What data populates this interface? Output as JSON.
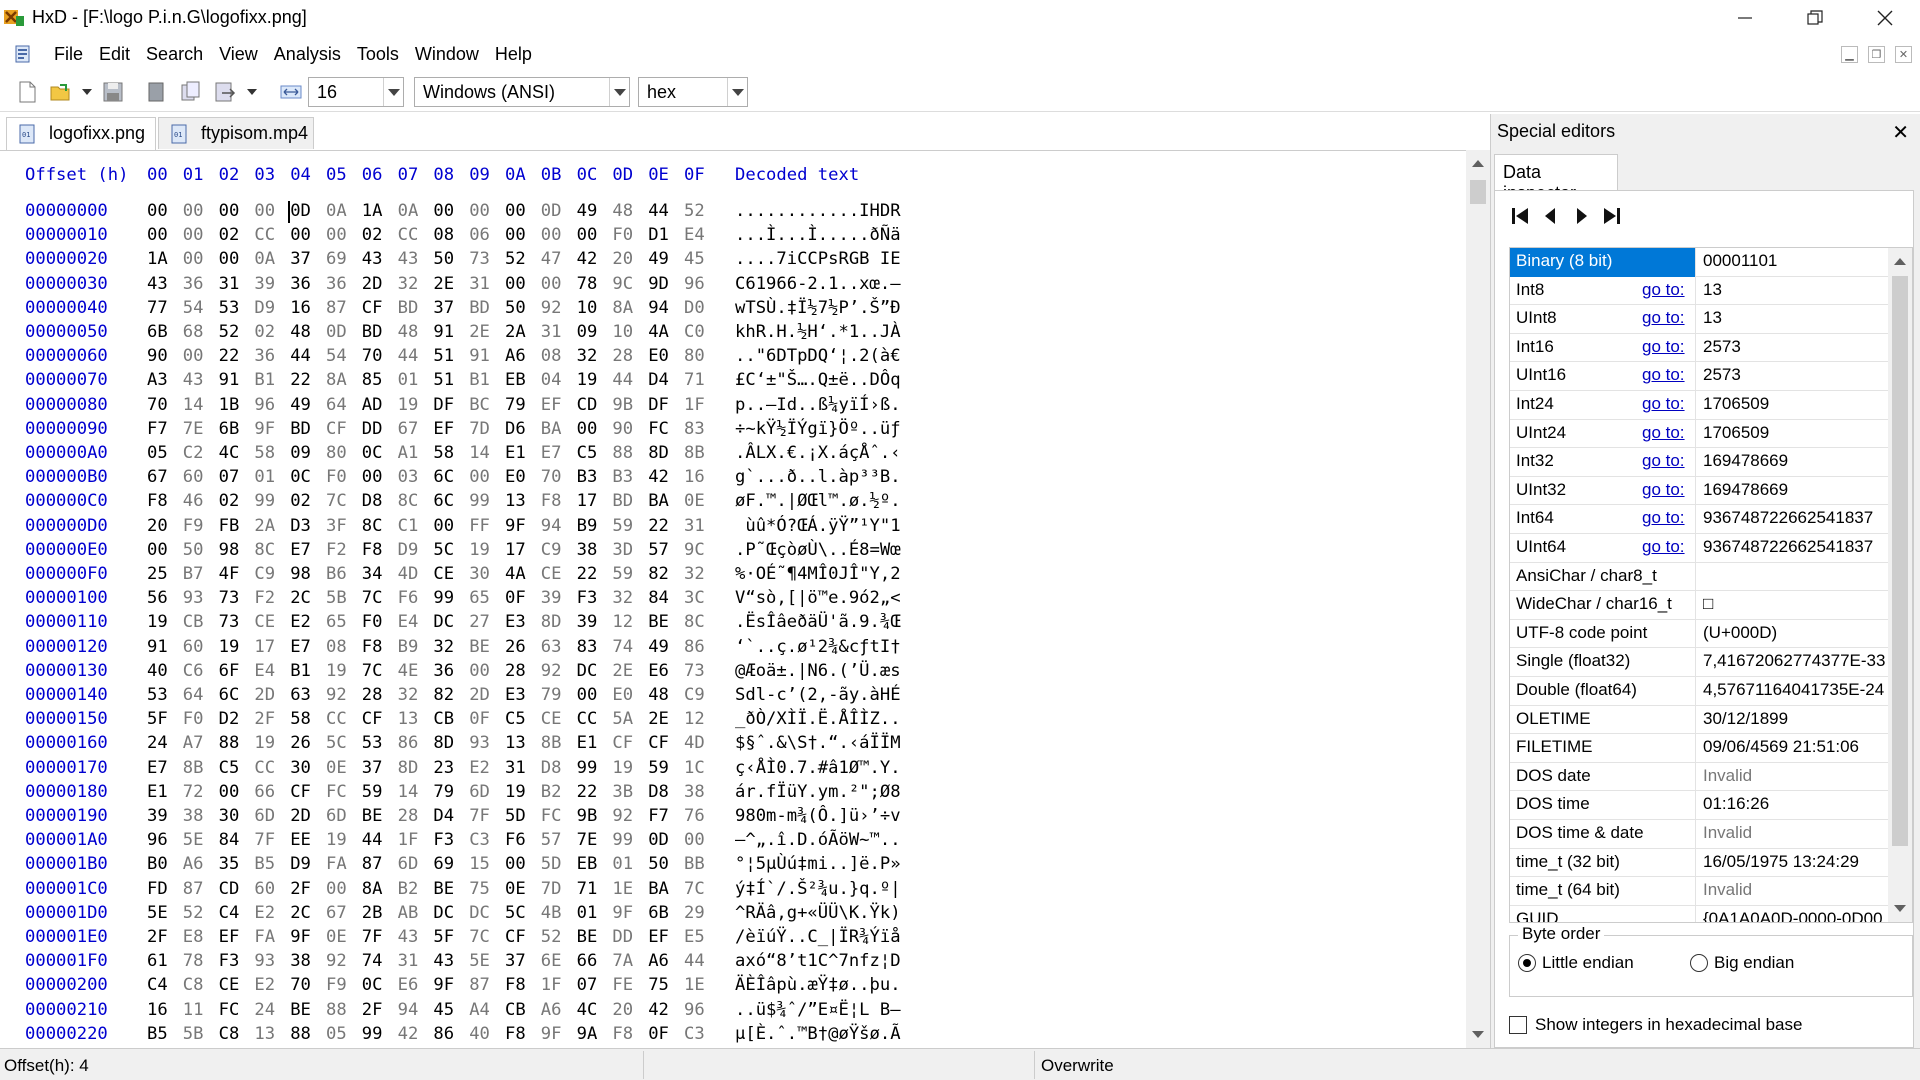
{
  "window": {
    "title": "HxD - [F:\\logo P.i.n.G\\logofixx.png]"
  },
  "menu": [
    "File",
    "Edit",
    "Search",
    "View",
    "Analysis",
    "Tools",
    "Window",
    "Help"
  ],
  "toolbar": {
    "bytes_per_row": "16",
    "charset": "Windows (ANSI)",
    "display": "hex"
  },
  "tabs": [
    {
      "label": "logofixx.png",
      "active": true
    },
    {
      "label": "ftypisom.mp4",
      "active": false
    }
  ],
  "hex": {
    "header_offset": "Offset (h)",
    "header_cols": [
      "00",
      "01",
      "02",
      "03",
      "04",
      "05",
      "06",
      "07",
      "08",
      "09",
      "0A",
      "0B",
      "0C",
      "0D",
      "0E",
      "0F"
    ],
    "header_decoded": "Decoded text",
    "rows": [
      {
        "o": "00000000",
        "b": "00 00 00 00 0D 0A 1A 0A 00 00 00 0D 49 48 44 52",
        "t": "............IHDR"
      },
      {
        "o": "00000010",
        "b": "00 00 02 CC 00 00 02 CC 08 06 00 00 00 F0 D1 E4",
        "t": "...Ì...Ì.....ðÑä"
      },
      {
        "o": "00000020",
        "b": "1A 00 00 0A 37 69 43 43 50 73 52 47 42 20 49 45",
        "t": "....7iCCPsRGB IE"
      },
      {
        "o": "00000030",
        "b": "43 36 31 39 36 36 2D 32 2E 31 00 00 78 9C 9D 96",
        "t": "C61966-2.1..xœ.–"
      },
      {
        "o": "00000040",
        "b": "77 54 53 D9 16 87 CF BD 37 BD 50 92 10 8A 94 D0",
        "t": "wTSÙ.‡Ï½7½P’.Š”Ð"
      },
      {
        "o": "00000050",
        "b": "6B 68 52 02 48 0D BD 48 91 2E 2A 31 09 10 4A C0",
        "t": "khR.H.½H‘.*1..JÀ"
      },
      {
        "o": "00000060",
        "b": "90 00 22 36 44 54 70 44 51 91 A6 08 32 28 E0 80",
        "t": "..\"6DTpDQ‘¦.2(à€"
      },
      {
        "o": "00000070",
        "b": "A3 43 91 B1 22 8A 85 01 51 B1 EB 04 19 44 D4 71",
        "t": "£C‘±\"Š….Q±ë..DÔq"
      },
      {
        "o": "00000080",
        "b": "70 14 1B 96 49 64 AD 19 DF BC 79 EF CD 9B DF 1F",
        "t": "p..–Id..ß¼yïÍ›ß."
      },
      {
        "o": "00000090",
        "b": "F7 7E 6B 9F BD CF DD 67 EF 7D D6 BA 00 90 FC 83",
        "t": "÷~kŸ½ÏÝgï}Öº..üƒ"
      },
      {
        "o": "000000A0",
        "b": "05 C2 4C 58 09 80 0C A1 58 14 E1 E7 C5 88 8D 8B",
        "t": ".ÂLX.€.¡X.áçÅˆ.‹"
      },
      {
        "o": "000000B0",
        "b": "67 60 07 01 0C F0 00 03 6C 00 E0 70 B3 B3 42 16",
        "t": "g`...ð..l.àp³³B."
      },
      {
        "o": "000000C0",
        "b": "F8 46 02 99 02 7C D8 8C 6C 99 13 F8 17 BD BA 0E",
        "t": "øF.™.|ØŒl™.ø.½º."
      },
      {
        "o": "000000D0",
        "b": "20 F9 FB 2A D3 3F 8C C1 00 FF 9F 94 B9 59 22 31",
        "t": " ùû*Ó?ŒÁ.ÿŸ”¹Y\"1"
      },
      {
        "o": "000000E0",
        "b": "00 50 98 8C E7 F2 F8 D9 5C 19 17 C9 38 3D 57 9C",
        "t": ".P˜ŒçòøÙ\\..É8=Wœ"
      },
      {
        "o": "000000F0",
        "b": "25 B7 4F C9 98 B6 34 4D CE 30 4A CE 22 59 82 32",
        "t": "%·OÉ˜¶4MÎ0JÎ\"Y‚2"
      },
      {
        "o": "00000100",
        "b": "56 93 73 F2 2C 5B 7C F6 99 65 0F 39 F3 32 84 3C",
        "t": "V“sò,[|ö™e.9ó2„<"
      },
      {
        "o": "00000110",
        "b": "19 CB 73 CE E2 65 F0 E4 DC 27 E3 8D 39 12 BE 8C",
        "t": ".ËsÎâeðäÜ'ã.9.¾Œ"
      },
      {
        "o": "00000120",
        "b": "91 60 19 17 E7 08 F8 B9 32 BE 26 63 83 74 49 86",
        "t": "‘`..ç.ø¹2¾&cƒtI†"
      },
      {
        "o": "00000130",
        "b": "40 C6 6F E4 B1 19 7C 4E 36 00 28 92 DC 2E E6 73",
        "t": "@Æoä±.|N6.(’Ü.æs"
      },
      {
        "o": "00000140",
        "b": "53 64 6C 2D 63 92 28 32 82 2D E3 79 00 E0 48 C9",
        "t": "Sdl-c’(2‚-ãy.àHÉ"
      },
      {
        "o": "00000150",
        "b": "5F F0 D2 2F 58 CC CF 13 CB 0F C5 CE CC 5A 2E 12",
        "t": "_ðÒ/XÌÏ.Ë.ÅÎÌZ.."
      },
      {
        "o": "00000160",
        "b": "24 A7 88 19 26 5C 53 86 8D 93 13 8B E1 CF CF 4D",
        "t": "$§ˆ.&\\S†.“.‹áÏÏM"
      },
      {
        "o": "00000170",
        "b": "E7 8B C5 CC 30 0E 37 8D 23 E2 31 D8 99 19 59 1C",
        "t": "ç‹ÅÌ0.7.#â1Ø™.Y."
      },
      {
        "o": "00000180",
        "b": "E1 72 00 66 CF FC 59 14 79 6D 19 B2 22 3B D8 38",
        "t": "ár.fÏüY.ym.²\";Ø8"
      },
      {
        "o": "00000190",
        "b": "39 38 30 6D 2D 6D BE 28 D4 7F 5D FC 9B 92 F7 76",
        "t": "980m-m¾(Ô.]ü›’÷v"
      },
      {
        "o": "000001A0",
        "b": "96 5E 84 7F EE 19 44 1F F3 C3 F6 57 7E 99 0D 00",
        "t": "–^„.î.D.óÃöW~™.."
      },
      {
        "o": "000001B0",
        "b": "B0 A6 35 B5 D9 FA 87 6D 69 15 00 5D EB 01 50 BB",
        "t": "°¦5µÙú‡mi..]ë.P»"
      },
      {
        "o": "000001C0",
        "b": "FD 87 CD 60 2F 00 8A B2 BE 75 0E 7D 71 1E BA 7C",
        "t": "ý‡Í`/.Š²¾u.}q.º|"
      },
      {
        "o": "000001D0",
        "b": "5E 52 C4 E2 2C 67 2B AB DC DC 5C 4B 01 9F 6B 29",
        "t": "^RÄâ,g+«ÜÜ\\K.Ÿk)"
      },
      {
        "o": "000001E0",
        "b": "2F E8 EF FA 9F 0E 7F 43 5F 7C CF 52 BE DD EF E5",
        "t": "/èïúŸ..C_|ÏR¾Ýïå"
      },
      {
        "o": "000001F0",
        "b": "61 78 F3 93 38 92 74 31 43 5E 37 6E 66 7A A6 44",
        "t": "axó“8’t1C^7nfz¦D"
      },
      {
        "o": "00000200",
        "b": "C4 C8 CE E2 70 F9 0C E6 9F 87 F8 1F 07 FE 75 1E",
        "t": "ÄÈÎâpù.æŸ‡ø..þu."
      },
      {
        "o": "00000210",
        "b": "16 11 FC 24 BE 88 2F 94 45 A4 CB A6 4C 20 42 96",
        "t": "..ü$¾ˆ/”E¤Ë¦L B–"
      },
      {
        "o": "00000220",
        "b": "B5 5B C8 13 88 05 99 42 86 40 F8 9F 9A F8 0F C3",
        "t": "µ[È.ˆ.™B†@øŸšø.Ã"
      }
    ]
  },
  "special_editors": {
    "title": "Special editors",
    "tab": "Data inspector",
    "goto_label": "go to:",
    "rows": [
      {
        "k": "Binary (8 bit)",
        "v": "00001101",
        "goto": false,
        "sel": true
      },
      {
        "k": "Int8",
        "v": "13",
        "goto": true
      },
      {
        "k": "UInt8",
        "v": "13",
        "goto": true
      },
      {
        "k": "Int16",
        "v": "2573",
        "goto": true
      },
      {
        "k": "UInt16",
        "v": "2573",
        "goto": true
      },
      {
        "k": "Int24",
        "v": "1706509",
        "goto": true
      },
      {
        "k": "UInt24",
        "v": "1706509",
        "goto": true
      },
      {
        "k": "Int32",
        "v": "169478669",
        "goto": true
      },
      {
        "k": "UInt32",
        "v": "169478669",
        "goto": true
      },
      {
        "k": "Int64",
        "v": "936748722662541837",
        "goto": true
      },
      {
        "k": "UInt64",
        "v": "936748722662541837",
        "goto": true
      },
      {
        "k": "AnsiChar / char8_t",
        "v": "",
        "goto": false
      },
      {
        "k": "WideChar / char16_t",
        "v": "□",
        "goto": false
      },
      {
        "k": "UTF-8 code point",
        "v": " (U+000D)",
        "goto": false
      },
      {
        "k": "Single (float32)",
        "v": "7,41672062774377E-33",
        "goto": false
      },
      {
        "k": "Double (float64)",
        "v": "4,57671164041735E-24",
        "goto": false
      },
      {
        "k": "OLETIME",
        "v": "30/12/1899",
        "goto": false
      },
      {
        "k": "FILETIME",
        "v": "09/06/4569 21:51:06",
        "goto": false
      },
      {
        "k": "DOS date",
        "v": "Invalid",
        "goto": false,
        "inv": true
      },
      {
        "k": "DOS time",
        "v": "01:16:26",
        "goto": false
      },
      {
        "k": "DOS time & date",
        "v": "Invalid",
        "goto": false,
        "inv": true
      },
      {
        "k": "time_t (32 bit)",
        "v": "16/05/1975 13:24:29",
        "goto": false
      },
      {
        "k": "time_t (64 bit)",
        "v": "Invalid",
        "goto": false,
        "inv": true
      },
      {
        "k": "GUID",
        "v": "{0A1A0A0D-0000-0D00",
        "goto": false
      }
    ],
    "byte_order_label": "Byte order",
    "little_endian": "Little endian",
    "big_endian": "Big endian",
    "hex_checkbox": "Show integers in hexadecimal base"
  },
  "status": {
    "offset": "Offset(h): 4",
    "mode": "Overwrite"
  }
}
